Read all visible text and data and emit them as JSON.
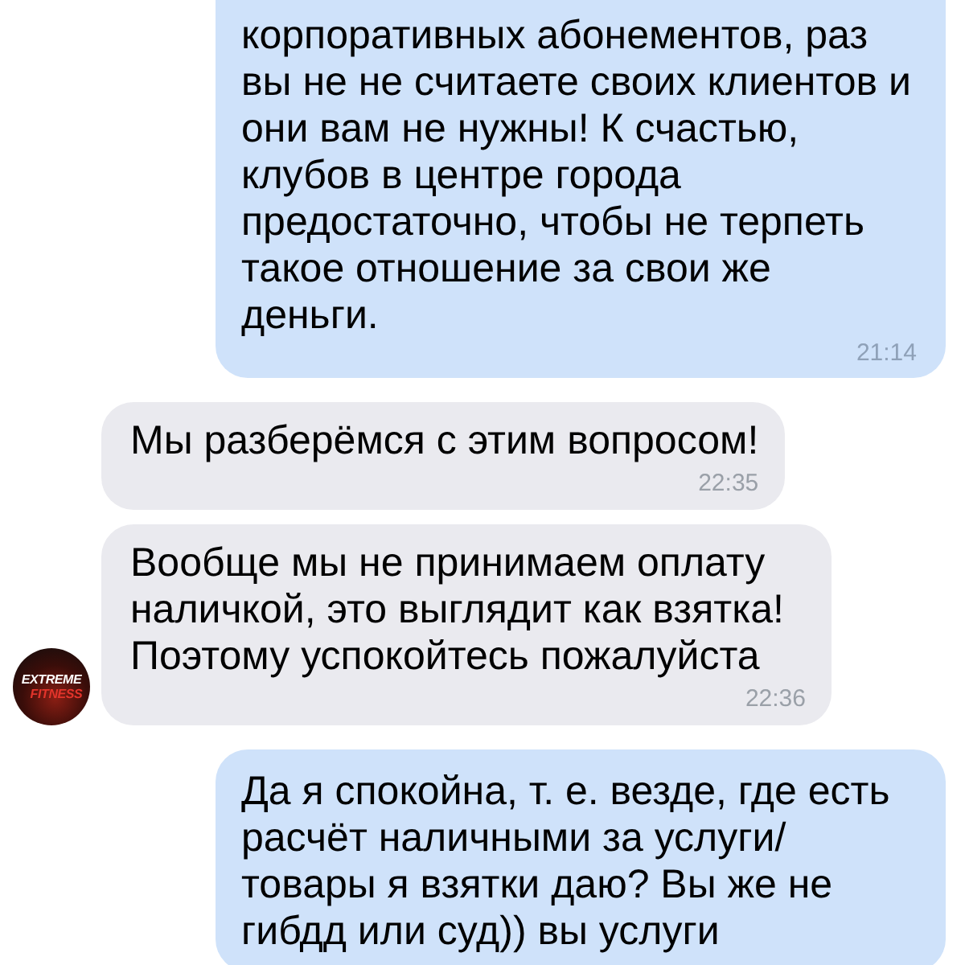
{
  "avatar": {
    "logo_lines": [
      "EXTREME",
      "FITNESS"
    ]
  },
  "messages": [
    {
      "kind": "outgoing",
      "text": "корпоративных абонементов, раз вы не не считаете своих клиентов и они вам не нужны! К счастью, клубов в центре города предостаточно, чтобы не терпеть такое отношение за свои же деньги.",
      "time": "21:14"
    },
    {
      "kind": "incoming",
      "text": "Мы разберёмся с этим вопросом!",
      "time": "22:35",
      "show_avatar": false
    },
    {
      "kind": "incoming",
      "text": "Вообще мы не принимаем оплату наличкой, это выглядит как взятка! Поэтому успокойтесь пожалуйста",
      "time": "22:36",
      "show_avatar": true
    },
    {
      "kind": "outgoing",
      "text": "Да я спокойна, т. е. везде, где есть расчёт наличными за услуги/товары я взятки даю? Вы же не гибдд или суд)) вы услуги"
    }
  ]
}
